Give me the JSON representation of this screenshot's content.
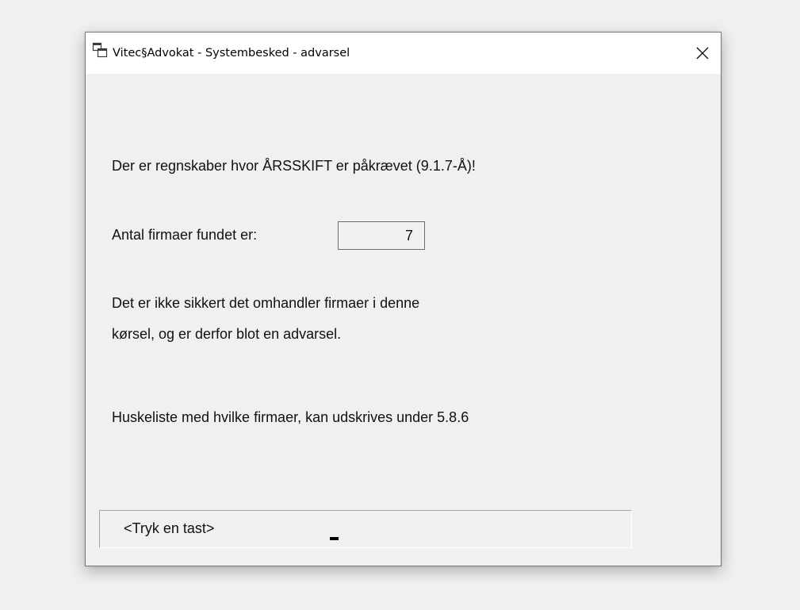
{
  "window": {
    "title": "Vitec§Advokat - Systembesked - advarsel",
    "close_symbol": "✕",
    "icon": "app-window-icon"
  },
  "message": {
    "line1": "Der er regnskaber hvor ÅRSSKIFT er påkrævet (9.1.7-Å)!",
    "count_label": "Antal firmaer fundet er:",
    "count_value": "7",
    "line3": "Det er ikke sikkert det omhandler firmaer i denne",
    "line4": "kørsel, og er derfor blot en advarsel.",
    "line5": "Huskeliste med hvilke firmaer, kan udskrives under 5.8.6"
  },
  "status": {
    "prompt": "<Tryk en tast>"
  }
}
